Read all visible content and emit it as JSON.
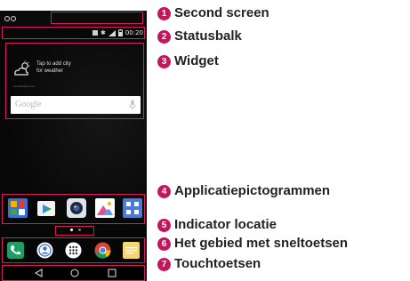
{
  "phone": {
    "status_time": "00:20",
    "widget": {
      "line1": "Tap to add city",
      "line2": "for weather",
      "credit": "AccuWeather.com"
    },
    "search": {
      "placeholder": "Google"
    },
    "apps": [
      {
        "icon": "folder-icon",
        "color": "#3b6fd6"
      },
      {
        "icon": "play-store-icon",
        "color": "#f2f2f2"
      },
      {
        "icon": "camera-icon",
        "color": "#dfe3ea"
      },
      {
        "icon": "gallery-icon",
        "color": "#ffffff"
      },
      {
        "icon": "apps-folder-icon",
        "color": "#4a7bd8"
      }
    ],
    "dock": [
      {
        "icon": "phone-icon",
        "color": "#1e9e63"
      },
      {
        "icon": "contacts-icon",
        "color": "#ffffff"
      },
      {
        "icon": "apps-drawer-icon",
        "color": "#ffffff"
      },
      {
        "icon": "chrome-icon",
        "color": "#ffffff"
      },
      {
        "icon": "messages-icon",
        "color": "#f5d76e"
      }
    ],
    "nav_keys": [
      "back-icon",
      "home-icon",
      "recents-icon"
    ],
    "highlight_color": "#d81b60"
  },
  "callouts": [
    {
      "number": "1",
      "label": "Second screen"
    },
    {
      "number": "2",
      "label": "Statusbalk"
    },
    {
      "number": "3",
      "label": "Widget"
    },
    {
      "number": "4",
      "label": "Applicatiepictogrammen"
    },
    {
      "number": "5",
      "label": "Indicator locatie"
    },
    {
      "number": "6",
      "label": "Het gebied met sneltoetsen"
    },
    {
      "number": "7",
      "label": "Touchtoetsen"
    }
  ]
}
